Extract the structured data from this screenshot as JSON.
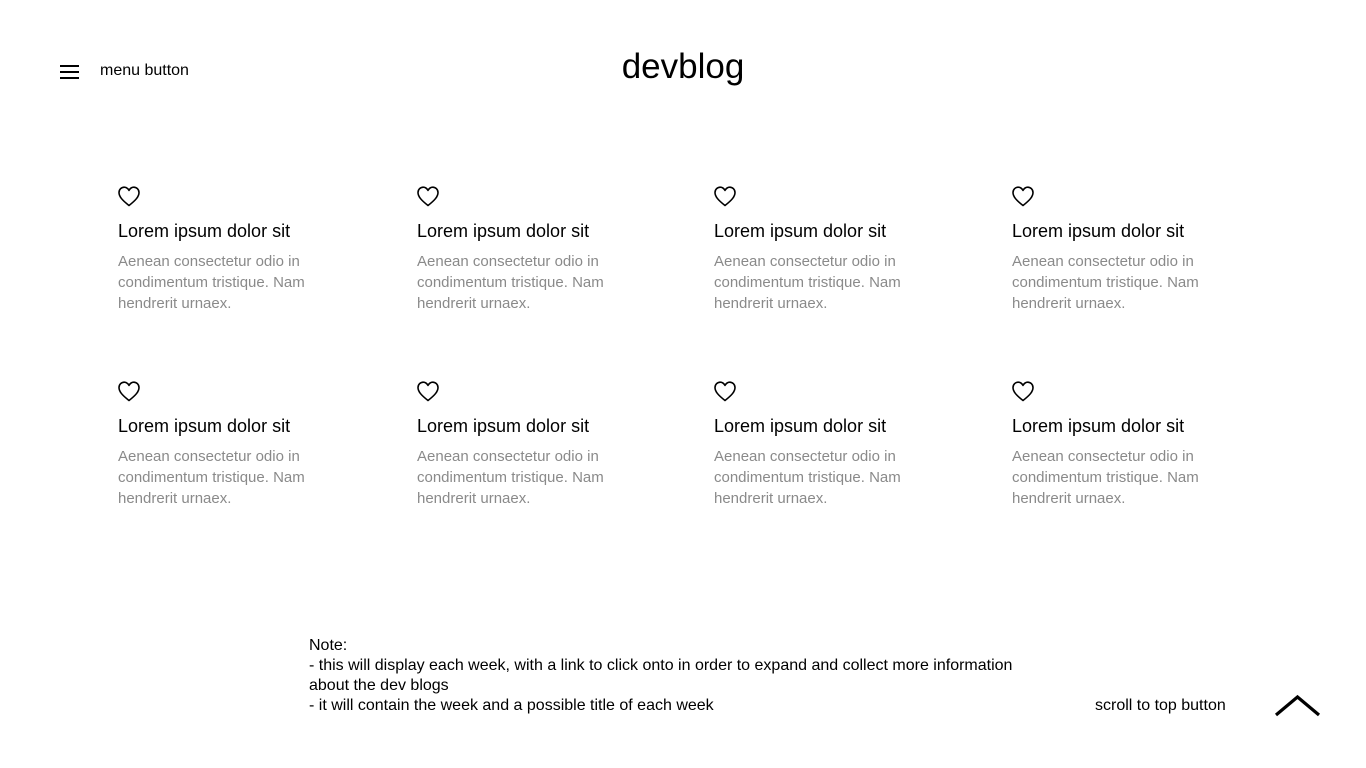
{
  "header": {
    "menu_label": "menu button",
    "menu_icon": "hamburger-icon",
    "site_title": "devblog"
  },
  "posts": [
    {
      "title": "Lorem ipsum dolor sit",
      "excerpt": "Aenean consectetur odio in condimentum tristique. Nam hendrerit urnaex.",
      "icon": "heart-icon"
    },
    {
      "title": "Lorem ipsum dolor sit",
      "excerpt": "Aenean consectetur odio in condimentum tristique. Nam hendrerit urnaex.",
      "icon": "heart-icon"
    },
    {
      "title": "Lorem ipsum dolor sit",
      "excerpt": "Aenean consectetur odio in condimentum tristique. Nam hendrerit urnaex.",
      "icon": "heart-icon"
    },
    {
      "title": "Lorem ipsum dolor sit",
      "excerpt": "Aenean consectetur odio in condimentum tristique. Nam hendrerit urnaex.",
      "icon": "heart-icon"
    },
    {
      "title": "Lorem ipsum dolor sit",
      "excerpt": "Aenean consectetur odio in condimentum tristique. Nam hendrerit urnaex.",
      "icon": "heart-icon"
    },
    {
      "title": "Lorem ipsum dolor sit",
      "excerpt": "Aenean consectetur odio in condimentum tristique. Nam hendrerit urnaex.",
      "icon": "heart-icon"
    },
    {
      "title": "Lorem ipsum dolor sit",
      "excerpt": "Aenean consectetur odio in condimentum tristique. Nam hendrerit urnaex.",
      "icon": "heart-icon"
    },
    {
      "title": "Lorem ipsum dolor sit",
      "excerpt": "Aenean consectetur odio in condimentum tristique. Nam hendrerit urnaex.",
      "icon": "heart-icon"
    }
  ],
  "note": {
    "heading": "Note:",
    "line1": "- this will display each week, with a link to click onto in order to expand and collect more information about the dev blogs",
    "line2": "- it will contain the week and a possible title of each week"
  },
  "scroll_top": {
    "label": "scroll to top button",
    "icon": "chevron-up-icon"
  },
  "colors": {
    "text": "#000000",
    "excerpt": "#8a8a8a",
    "background": "#ffffff"
  }
}
